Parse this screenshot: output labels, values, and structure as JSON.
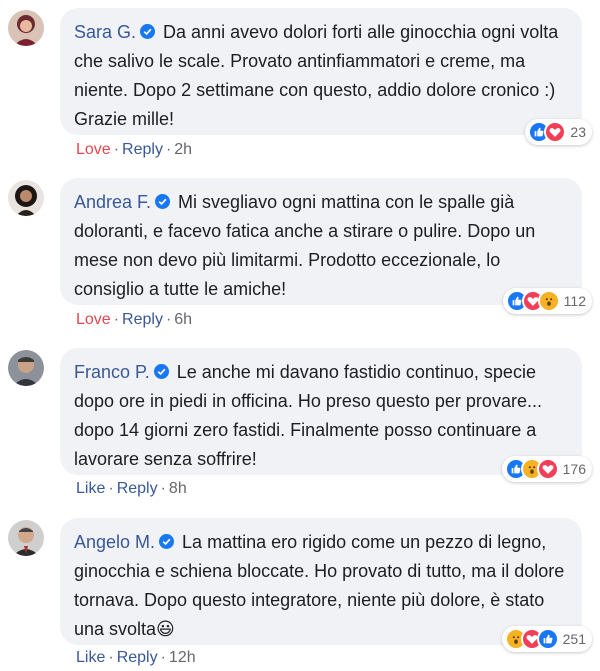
{
  "comments": [
    {
      "author": "Sara G.",
      "text": "Da anni avevo dolori forti alle ginocchia ogni volta che salivo le scale. Provato antinfiammatori e creme, ma niente. Dopo 2 settimane con questo, addio dolore cronico :) Grazie mille!",
      "reactions": [
        "like-icon",
        "love-icon"
      ],
      "reaction_count": "23",
      "action": "Love",
      "reply": "Reply",
      "time": "2h"
    },
    {
      "author": "Andrea F.",
      "text": "Mi svegliavo ogni mattina con le spalle già doloranti, e facevo fatica anche a stirare o pulire. Dopo un mese non devo più limitarmi. Prodotto eccezionale, lo consiglio a tutte le amiche!",
      "reactions": [
        "like-icon",
        "love-icon",
        "wow-icon"
      ],
      "reaction_count": "112",
      "action": "Love",
      "reply": "Reply",
      "time": "6h"
    },
    {
      "author": "Franco P.",
      "text": "Le anche mi davano fastidio continuo, specie dopo ore in piedi in officina. Ho preso questo per provare... dopo 14 giorni zero fastidi. Finalmente posso continuare a lavorare senza soffrire!",
      "reactions": [
        "like-icon",
        "wow-icon",
        "love-icon"
      ],
      "reaction_count": "176",
      "action": "Like",
      "reply": "Reply",
      "time": "8h"
    },
    {
      "author": "Angelo M.",
      "text": "La mattina ero rigido come un pezzo di legno, ginocchia e schiena bloccate. Ho provato di tutto, ma il dolore tornava. Dopo questo integratore, niente più dolore, è stato una svolta😃",
      "reactions": [
        "wow-icon",
        "love-icon",
        "like-icon"
      ],
      "reaction_count": "251",
      "action": "Like",
      "reply": "Reply",
      "time": "12h"
    }
  ],
  "colors": {
    "author": "#385898",
    "bubble": "#f0f2f5",
    "love_action": "#e5474f",
    "like_reaction": "#1877f2",
    "love_reaction": "#f33e58",
    "wow_reaction": "#f7b125"
  }
}
